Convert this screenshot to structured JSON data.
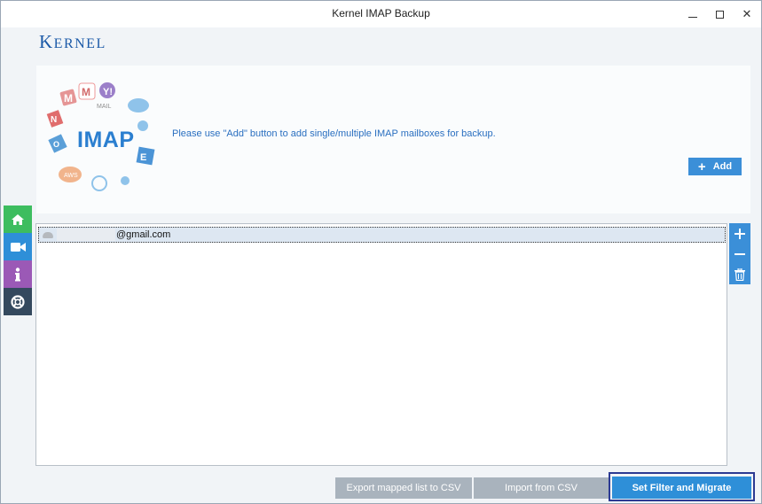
{
  "window": {
    "title": "Kernel IMAP Backup"
  },
  "brand": {
    "logo_text": "Kernel"
  },
  "banner": {
    "art_label": "IMAP",
    "message": "Please use \"Add\" button to add single/multiple IMAP mailboxes for backup.",
    "add_label": "Add"
  },
  "side_nav": [
    {
      "name": "home",
      "icon": "home-icon",
      "color": "#3dbd5f"
    },
    {
      "name": "video",
      "icon": "video-camera-icon",
      "color": "#2e8fd8"
    },
    {
      "name": "info",
      "icon": "info-icon",
      "color": "#9b59b6"
    },
    {
      "name": "help",
      "icon": "lifebuoy-icon",
      "color": "#34495e"
    }
  ],
  "mailbox_list": {
    "items": [
      {
        "account": "@gmail.com",
        "selected": true
      }
    ]
  },
  "list_actions": {
    "icons": [
      "plus-icon",
      "minus-icon",
      "trash-icon"
    ]
  },
  "footer": {
    "export_label": "Export mapped list to CSV",
    "import_label": "Import from CSV",
    "migrate_label": "Set Filter and Migrate"
  },
  "colors": {
    "accent": "#2e8fd8",
    "brand": "#1c5aa8",
    "disabled_button": "#a9b3bd",
    "focus_frame": "#2c3a93"
  }
}
